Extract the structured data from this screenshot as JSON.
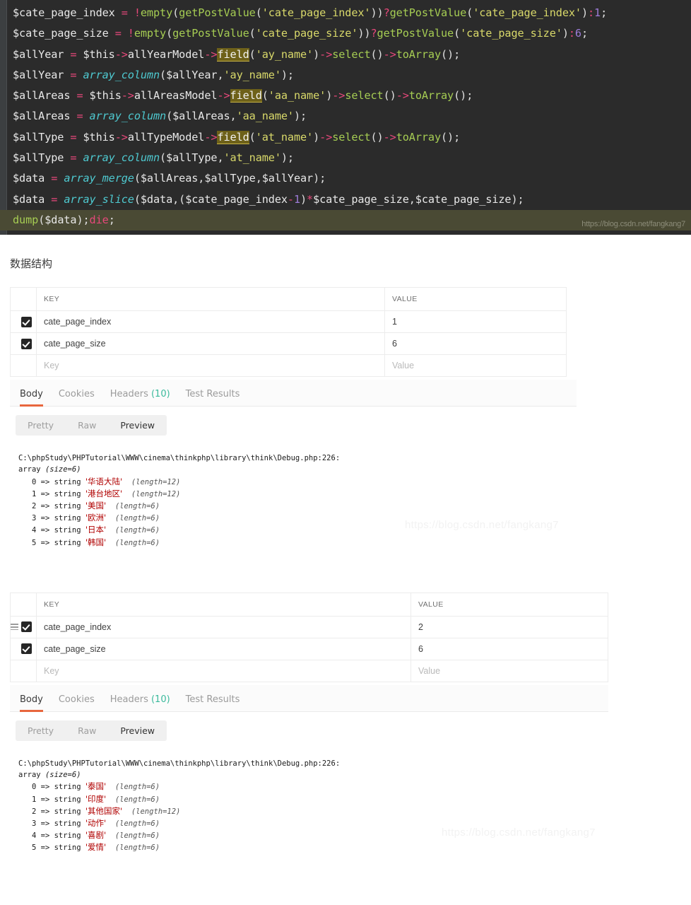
{
  "code_block": {
    "watermark": "https://blog.csdn.net/fangkang7",
    "lines": [
      "$cate_page_index = !empty(getPostValue('cate_page_index'))?getPostValue('cate_page_index'):1;",
      "$cate_page_size = !empty(getPostValue('cate_page_size'))?getPostValue('cate_page_size'):6;",
      "$allYear = $this->allYearModel->field('ay_name')->select()->toArray();",
      "$allYear = array_column($allYear,'ay_name');",
      "$allAreas = $this->allAreasModel->field('aa_name')->select()->toArray();",
      "$allAreas = array_column($allAreas,'aa_name');",
      "$allType = $this->allTypeModel->field('at_name')->select()->toArray();",
      "$allType = array_column($allType,'at_name');",
      "$data = array_merge($allAreas,$allType,$allYear);",
      "$data = array_slice($data,($cate_page_index-1)*$cate_page_size,$cate_page_size);",
      "dump($data);die;"
    ],
    "tokens": {
      "v_cate_page_index": "$cate_page_index",
      "v_cate_page_size": "$cate_page_size",
      "v_allYear": "$allYear",
      "v_allAreas": "$allAreas",
      "v_allType": "$allType",
      "v_data": "$data",
      "v_this": "$this",
      "eq": " = ",
      "bang": "!",
      "fn_empty": "empty",
      "fn_getPostValue": "getPostValue",
      "fn_array_column": "array_column",
      "fn_array_merge": "array_merge",
      "fn_array_slice": "array_slice",
      "fn_field": "field",
      "fn_select": "select",
      "fn_toArray": "toArray",
      "fn_dump": "dump",
      "kw_die": "die",
      "s_cate_page_index": "'cate_page_index'",
      "s_cate_page_size": "'cate_page_size'",
      "s_ay_name": "'ay_name'",
      "s_aa_name": "'aa_name'",
      "s_at_name": "'at_name'",
      "n_1": "1",
      "n_6": "6",
      "arrow": "->",
      "m_allYearModel": "allYearModel",
      "m_allAreasModel": "allAreasModel",
      "m_allTypeModel": "allTypeModel"
    }
  },
  "section_title": "数据结构",
  "request1": {
    "table": {
      "headers": {
        "key": "KEY",
        "value": "VALUE"
      },
      "rows": [
        {
          "checked": true,
          "drag": false,
          "key": "cate_page_index",
          "value": "1"
        },
        {
          "checked": true,
          "drag": false,
          "key": "cate_page_size",
          "value": "6"
        }
      ],
      "placeholder_row": {
        "key": "Key",
        "value": "Value"
      }
    },
    "tabs": [
      {
        "label": "Body",
        "active": true,
        "count": ""
      },
      {
        "label": "Cookies",
        "active": false,
        "count": ""
      },
      {
        "label": "Headers",
        "active": false,
        "count": "(10)"
      },
      {
        "label": "Test Results",
        "active": false,
        "count": ""
      }
    ],
    "view_modes": [
      {
        "label": "Pretty",
        "active": false
      },
      {
        "label": "Raw",
        "active": false
      },
      {
        "label": "Preview",
        "active": true
      }
    ],
    "output": {
      "path": "C:\\phpStudy\\PHPTutorial\\WWW\\cinema\\thinkphp\\library\\think\\Debug.php:226:",
      "array_header": "array",
      "array_size": "(size=6)",
      "items": [
        {
          "index": "0",
          "type": "string",
          "value": "'华语大陆'",
          "length": "(length=12)"
        },
        {
          "index": "1",
          "type": "string",
          "value": "'港台地区'",
          "length": "(length=12)"
        },
        {
          "index": "2",
          "type": "string",
          "value": "'美国'",
          "length": "(length=6)"
        },
        {
          "index": "3",
          "type": "string",
          "value": "'欧洲'",
          "length": "(length=6)"
        },
        {
          "index": "4",
          "type": "string",
          "value": "'日本'",
          "length": "(length=6)"
        },
        {
          "index": "5",
          "type": "string",
          "value": "'韩国'",
          "length": "(length=6)"
        }
      ]
    },
    "watermark": "https://blog.csdn.net/fangkang7"
  },
  "request2": {
    "table": {
      "headers": {
        "key": "KEY",
        "value": "VALUE"
      },
      "rows": [
        {
          "checked": true,
          "drag": true,
          "key": "cate_page_index",
          "value": "2"
        },
        {
          "checked": true,
          "drag": false,
          "key": "cate_page_size",
          "value": "6"
        }
      ],
      "placeholder_row": {
        "key": "Key",
        "value": "Value"
      }
    },
    "tabs": [
      {
        "label": "Body",
        "active": true,
        "count": ""
      },
      {
        "label": "Cookies",
        "active": false,
        "count": ""
      },
      {
        "label": "Headers",
        "active": false,
        "count": "(10)"
      },
      {
        "label": "Test Results",
        "active": false,
        "count": ""
      }
    ],
    "view_modes": [
      {
        "label": "Pretty",
        "active": false
      },
      {
        "label": "Raw",
        "active": false
      },
      {
        "label": "Preview",
        "active": true
      }
    ],
    "output": {
      "path": "C:\\phpStudy\\PHPTutorial\\WWW\\cinema\\thinkphp\\library\\think\\Debug.php:226:",
      "array_header": "array",
      "array_size": "(size=6)",
      "items": [
        {
          "index": "0",
          "type": "string",
          "value": "'泰国'",
          "length": "(length=6)"
        },
        {
          "index": "1",
          "type": "string",
          "value": "'印度'",
          "length": "(length=6)"
        },
        {
          "index": "2",
          "type": "string",
          "value": "'其他国家'",
          "length": "(length=12)"
        },
        {
          "index": "3",
          "type": "string",
          "value": "'动作'",
          "length": "(length=6)"
        },
        {
          "index": "4",
          "type": "string",
          "value": "'喜剧'",
          "length": "(length=6)"
        },
        {
          "index": "5",
          "type": "string",
          "value": "'爱情'",
          "length": "(length=6)"
        }
      ]
    },
    "watermark": "https://blog.csdn.net/fangkang7"
  },
  "colors": {
    "code_bg": "#2b2b2b",
    "code_gutter": "#3c3f41",
    "highlight_line": "#4a4a34",
    "accent_tab": "#e8663d",
    "count_green": "#3bba9c",
    "string_red": "#b00000",
    "token_pink": "#e8487b",
    "token_green": "#a6cd53",
    "token_yellow": "#d9d96a",
    "token_cyan": "#4ec9d0",
    "token_purple": "#9d7cd8"
  }
}
